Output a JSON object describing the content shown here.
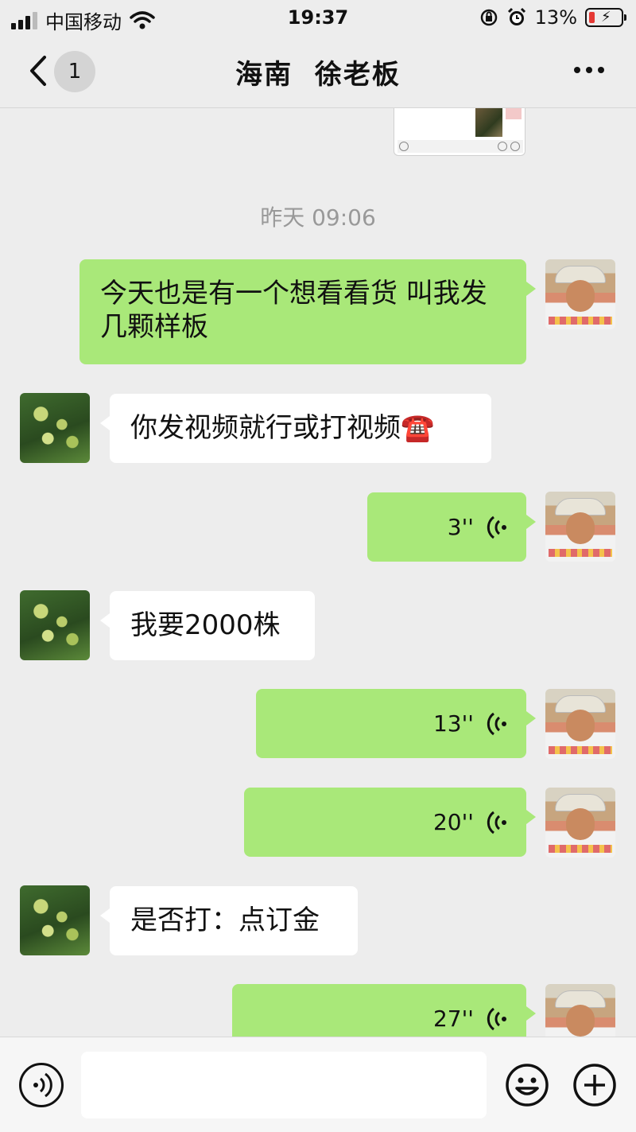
{
  "status": {
    "carrier": "中国移动",
    "time": "19:37",
    "battery": "13%"
  },
  "nav": {
    "badge": "1",
    "title": "海南 徐老板"
  },
  "chat": {
    "timestamp": "昨天 09:06",
    "messages": [
      {
        "dir": "out",
        "type": "text",
        "text": "今天也是有一个想看看货 叫我发几颗样板"
      },
      {
        "dir": "in",
        "type": "text",
        "text": "你发视频就行或打视频☎️"
      },
      {
        "dir": "out",
        "type": "voice",
        "duration": "3''"
      },
      {
        "dir": "in",
        "type": "text",
        "text": "我要2000株"
      },
      {
        "dir": "out",
        "type": "voice",
        "duration": "13''"
      },
      {
        "dir": "out",
        "type": "voice",
        "duration": "20''"
      },
      {
        "dir": "in",
        "type": "text",
        "text": "是否打：点订金"
      },
      {
        "dir": "out",
        "type": "voice",
        "duration": "27''"
      }
    ]
  },
  "colors": {
    "outgoing_bubble": "#a9e879",
    "incoming_bubble": "#ffffff",
    "background": "#ededed"
  }
}
